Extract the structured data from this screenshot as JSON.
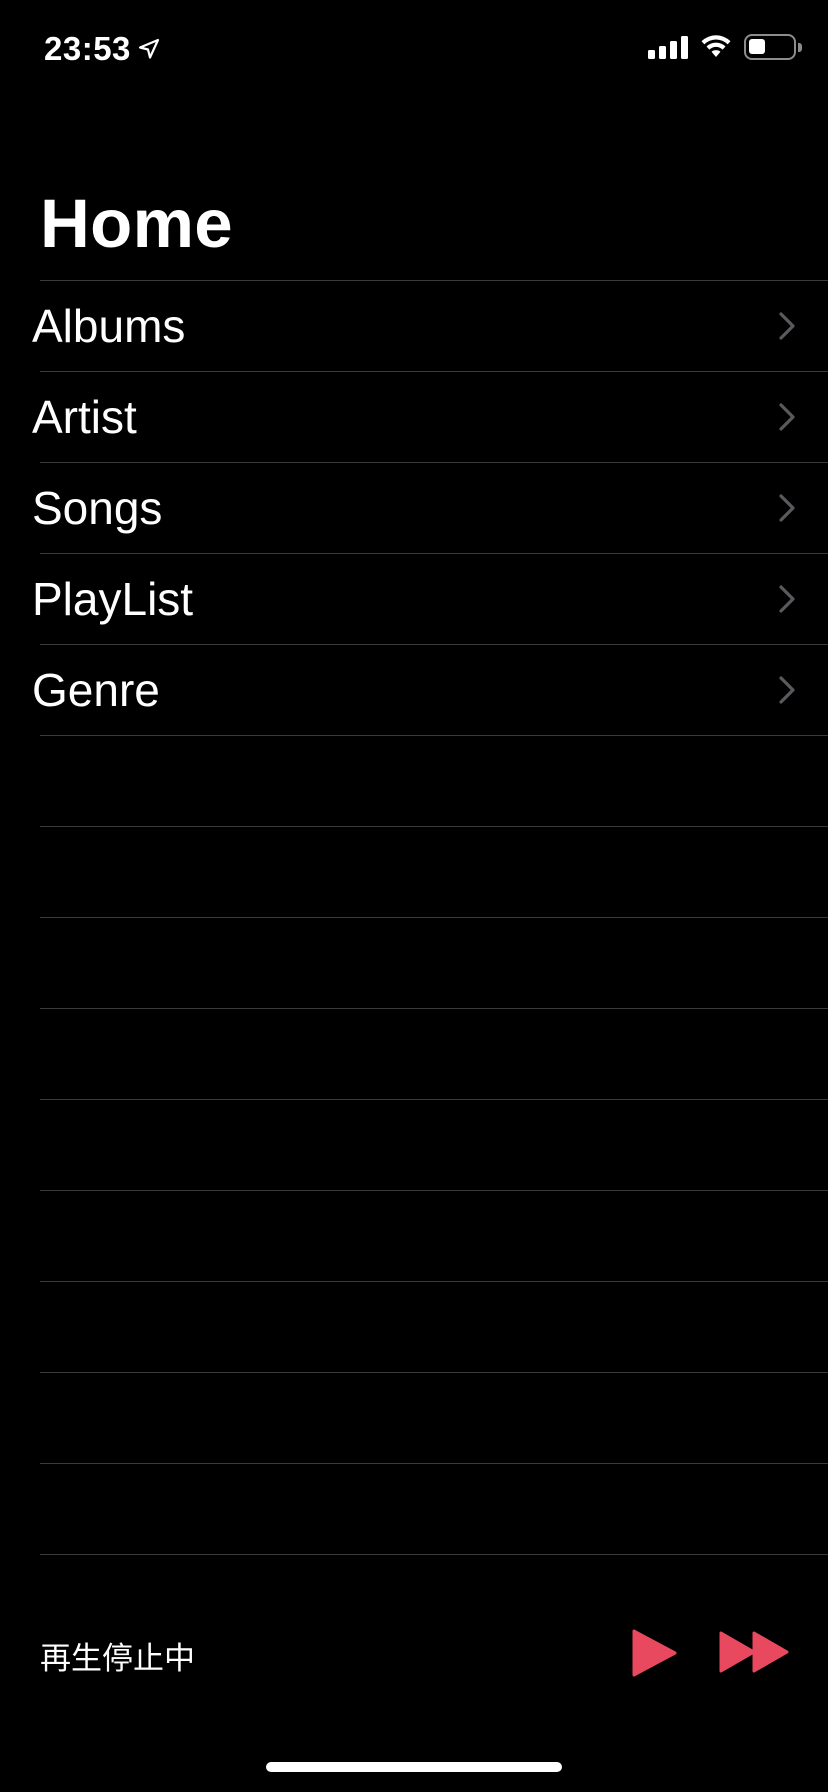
{
  "status_bar": {
    "time": "23:53",
    "location_icon": "location-arrow-icon",
    "signal_icon": "cellular-signal-icon",
    "wifi_icon": "wifi-icon",
    "battery_icon": "battery-icon",
    "battery_level": 0.4
  },
  "page": {
    "title": "Home"
  },
  "list": {
    "items": [
      {
        "label": "Albums",
        "icon": "chevron-right-icon"
      },
      {
        "label": "Artist",
        "icon": "chevron-right-icon"
      },
      {
        "label": "Songs",
        "icon": "chevron-right-icon"
      },
      {
        "label": "PlayList",
        "icon": "chevron-right-icon"
      },
      {
        "label": "Genre",
        "icon": "chevron-right-icon"
      }
    ]
  },
  "player": {
    "status_text": "再生停止中",
    "play_icon": "play-icon",
    "fast_forward_icon": "fast-forward-icon",
    "accent_color": "#E8495F"
  },
  "colors": {
    "background": "#000000",
    "separator": "#3A3A3C",
    "chevron": "#5A5A5E",
    "text": "#FFFFFF"
  }
}
